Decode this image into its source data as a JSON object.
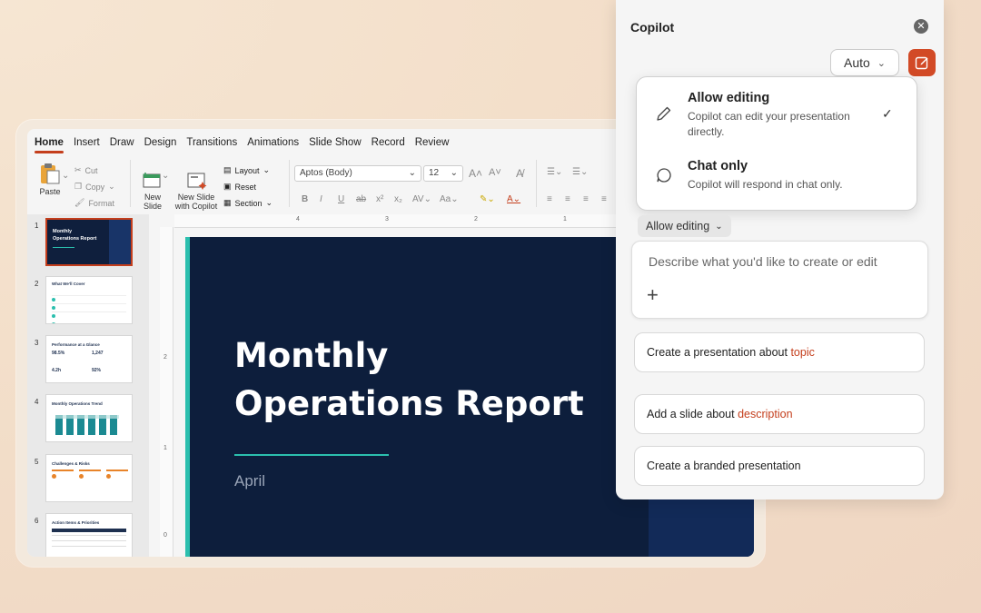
{
  "ribbon": {
    "tabs": [
      "Home",
      "Insert",
      "Draw",
      "Design",
      "Transitions",
      "Animations",
      "Slide Show",
      "Record",
      "Review"
    ],
    "active_tab": "Home",
    "paste_label": "Paste",
    "cut_label": "Cut",
    "copy_label": "Copy",
    "format_label": "Format",
    "new_slide_label": "New\nSlide",
    "new_slide_copilot_label": "New Slide\nwith Copilot",
    "layout_label": "Layout",
    "reset_label": "Reset",
    "section_label": "Section",
    "font_name": "Aptos (Body)",
    "font_size": "12"
  },
  "ruler": {
    "h": [
      "4",
      "3",
      "2",
      "1"
    ],
    "v": [
      "2",
      "1",
      "0"
    ]
  },
  "thumbnails": [
    {
      "num": "1",
      "title": "Monthly\nOperations Report"
    },
    {
      "num": "2",
      "title": "What We'll Cover"
    },
    {
      "num": "3",
      "title": "Performance at a Glance",
      "stats": [
        "98.5%",
        "1,247",
        "4.2h",
        "92%"
      ]
    },
    {
      "num": "4",
      "title": "Monthly Operations Trend"
    },
    {
      "num": "5",
      "title": "Challenges & Risks"
    },
    {
      "num": "6",
      "title": "Action Items & Priorities"
    }
  ],
  "slide": {
    "title": "Monthly\nOperations Report",
    "subtitle": "April"
  },
  "copilot": {
    "title": "Copilot",
    "model_label": "Auto",
    "menu": [
      {
        "title": "Allow editing",
        "desc": "Copilot can edit your presentation directly.",
        "checked": true
      },
      {
        "title": "Chat only",
        "desc": "Copilot will respond in chat only.",
        "checked": false
      }
    ],
    "mode_label": "Allow editing",
    "prompt_placeholder": "Describe what you'd like to create or edit",
    "suggestions": [
      {
        "text": "Create a presentation about ",
        "highlight": "topic"
      },
      {
        "text": "Add a slide about ",
        "highlight": "description"
      },
      {
        "text": "Create a branded presentation",
        "highlight": ""
      }
    ],
    "colors": {
      "accent": "#d24a26",
      "highlight": "#c43e1c"
    }
  }
}
